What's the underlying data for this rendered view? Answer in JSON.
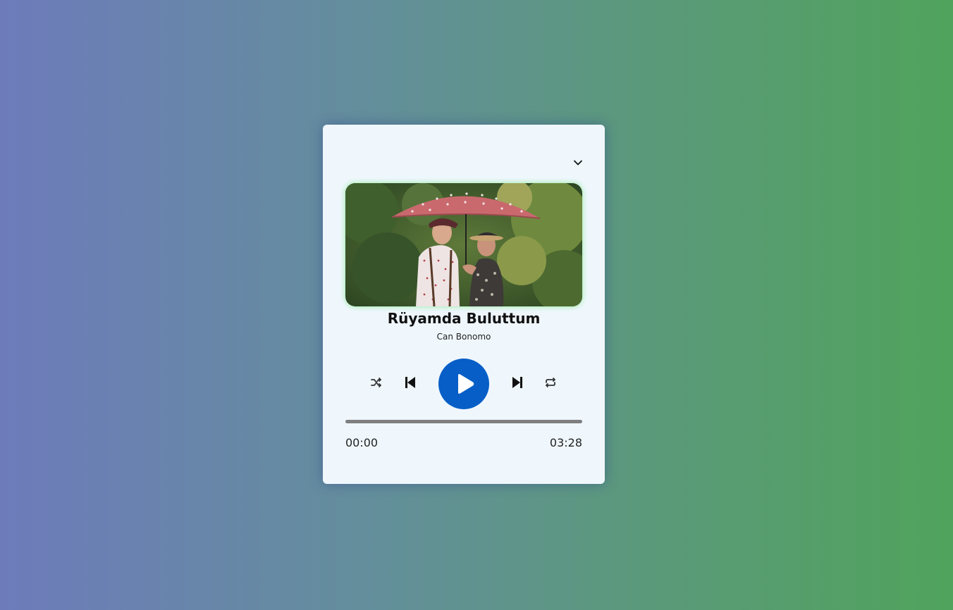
{
  "player": {
    "song_title": "Rüyamda Buluttum",
    "artist": "Can Bonomo",
    "current_time": "00:00",
    "total_time": "03:28",
    "progress": 0,
    "state": "paused",
    "accent_color": "#075ec7"
  },
  "icons": {
    "collapse": "chevron-down-icon",
    "shuffle": "shuffle-icon",
    "previous": "skip-previous-icon",
    "play": "play-icon",
    "next": "skip-next-icon",
    "repeat": "repeat-icon"
  }
}
